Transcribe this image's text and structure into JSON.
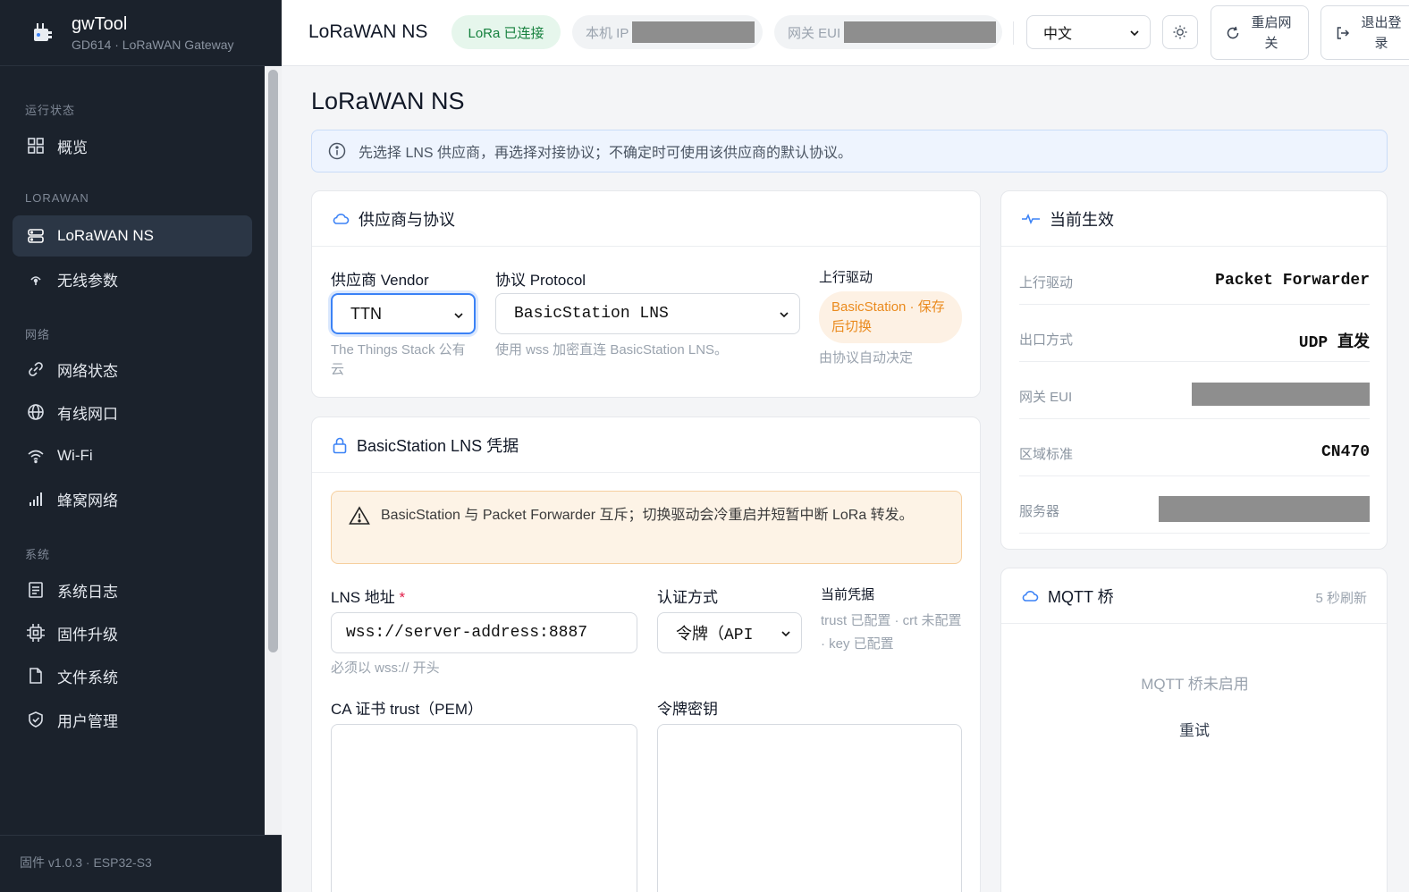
{
  "app": {
    "name": "gwTool",
    "subtitle": "GD614 · LoRaWAN Gateway"
  },
  "sidebar": {
    "sections": {
      "status": "运行状态",
      "lorawan": "LORAWAN",
      "network": "网络",
      "system": "系统"
    },
    "items": [
      {
        "label": "概览",
        "icon": "grid-icon"
      },
      {
        "label": "LoRaWAN NS",
        "icon": "server-icon",
        "active": true
      },
      {
        "label": "无线参数",
        "icon": "antenna-icon"
      },
      {
        "label": "网络状态",
        "icon": "link-icon"
      },
      {
        "label": "有线网口",
        "icon": "globe-icon"
      },
      {
        "label": "Wi-Fi",
        "icon": "wifi-icon"
      },
      {
        "label": "蜂窝网络",
        "icon": "signal-bars-icon"
      },
      {
        "label": "系统日志",
        "icon": "log-icon"
      },
      {
        "label": "固件升级",
        "icon": "chip-icon"
      },
      {
        "label": "文件系统",
        "icon": "file-icon"
      },
      {
        "label": "用户管理",
        "icon": "shield-icon"
      }
    ],
    "footer": "固件 v1.0.3 · ESP32-S3"
  },
  "topbar": {
    "title": "LoRaWAN NS",
    "lora_status": "LoRa 已连接",
    "local_ip_label": "本机 IP",
    "gateway_eui_label": "网关 EUI",
    "language": "中文",
    "reboot": "重启网关",
    "logout": "退出登录"
  },
  "page": {
    "title": "LoRaWAN NS",
    "info": "先选择 LNS 供应商，再选择对接协议；不确定时可使用该供应商的默认协议。"
  },
  "vendor_card": {
    "title": "供应商与协议",
    "vendor_label": "供应商 Vendor",
    "vendor_value": "TTN",
    "vendor_hint": "The Things Stack 公有云",
    "protocol_label": "协议 Protocol",
    "protocol_value": "BasicStation LNS",
    "protocol_hint": "使用 wss 加密直连 BasicStation LNS。",
    "uplink_label": "上行驱动",
    "uplink_badge": "BasicStation · 保存后切换",
    "uplink_hint": "由协议自动决定"
  },
  "cred_card": {
    "title": "BasicStation LNS 凭据",
    "warning": "BasicStation 与 Packet Forwarder 互斥；切换驱动会冷重启并短暂中断 LoRa 转发。",
    "lns_label": "LNS 地址",
    "required_mark": "*",
    "lns_value": "wss://server-address:8887",
    "lns_hint": "必须以 wss:// 开头",
    "auth_label": "认证方式",
    "auth_value": "令牌（API",
    "current_label": "当前凭据",
    "current_value": "trust 已配置 · crt 未配置 · key 已配置",
    "ca_label": "CA 证书 trust（PEM）",
    "token_label": "令牌密钥"
  },
  "effective_card": {
    "title": "当前生效",
    "rows": [
      {
        "key": "上行驱动",
        "value": "Packet Forwarder"
      },
      {
        "key": "出口方式",
        "value": "UDP 直发"
      },
      {
        "key": "网关 EUI",
        "value": ""
      },
      {
        "key": "区域标准",
        "value": "CN470"
      },
      {
        "key": "服务器",
        "value": ""
      }
    ]
  },
  "mqtt_card": {
    "title": "MQTT 桥",
    "refresh": "5 秒刷新",
    "status": "MQTT 桥未启用",
    "retry": "重试"
  }
}
